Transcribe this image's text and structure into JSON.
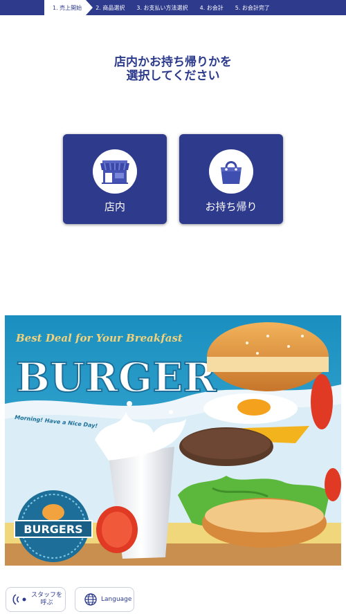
{
  "steps": [
    {
      "label": "1. 売上開始",
      "active": true
    },
    {
      "label": "2. 商品選択",
      "active": false
    },
    {
      "label": "3. お支払い方法選択",
      "active": false
    },
    {
      "label": "4. お会計",
      "active": false
    },
    {
      "label": "5. お会計完了",
      "active": false
    }
  ],
  "heading": {
    "line1": "店内かお持ち帰りかを",
    "line2": "選択してください"
  },
  "options": {
    "eat_in": {
      "label": "店内",
      "icon": "store-icon"
    },
    "takeout": {
      "label": "お持ち帰り",
      "icon": "shopping-bag-icon"
    }
  },
  "banner": {
    "tagline": "Best Deal for Your Breakfast",
    "title": "BURGER",
    "subtitle": "Morning! Have a Nice Day!",
    "badge": "BURGERS"
  },
  "footer": {
    "staff_line1": "スタッフを",
    "staff_line2": "呼ぶ",
    "language": "Language"
  },
  "colors": {
    "primary": "#2e3a8c",
    "background": "#ffffff",
    "banner_sky": "#1e9cc4"
  }
}
